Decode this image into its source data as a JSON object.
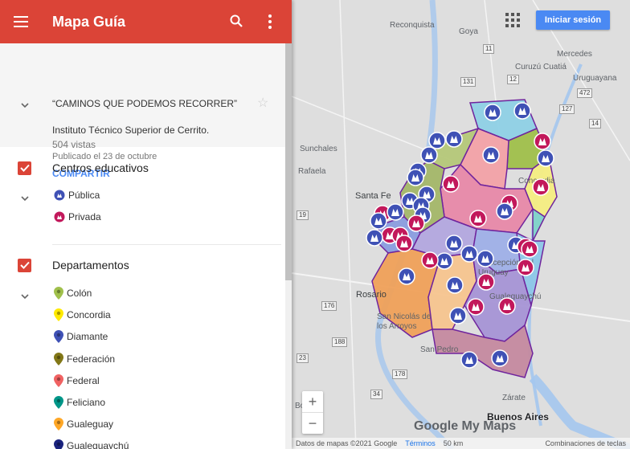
{
  "app_title": "Mapa Guía",
  "map_info": {
    "title": "“CAMINOS QUE PODEMOS RECORRER”",
    "description": "Instituto Técnico Superior de Cerrito.",
    "views": "504 vistas",
    "published": "Publicado el 23 de octubre",
    "share_label": "COMPARTIR"
  },
  "layers": [
    {
      "name": "Centros educativos",
      "items": [
        {
          "label": "Pública",
          "color": "#3f51b5",
          "icon": "school-pin-icon"
        },
        {
          "label": "Privada",
          "color": "#c2185b",
          "icon": "school-pin-icon"
        }
      ]
    },
    {
      "name": "Departamentos",
      "items": [
        {
          "label": "Colón",
          "color": "#a0c04b",
          "icon": "map-pin-icon"
        },
        {
          "label": "Concordia",
          "color": "#ffea00",
          "icon": "map-pin-icon"
        },
        {
          "label": "Diamante",
          "color": "#3f51b5",
          "icon": "map-pin-icon"
        },
        {
          "label": "Federación",
          "color": "#827717",
          "icon": "map-pin-icon"
        },
        {
          "label": "Federal",
          "color": "#f06262",
          "icon": "map-pin-icon"
        },
        {
          "label": "Feliciano",
          "color": "#009688",
          "icon": "map-pin-icon"
        },
        {
          "label": "Gualeguay",
          "color": "#ffa726",
          "icon": "map-pin-icon"
        },
        {
          "label": "Gualeguaychú",
          "color": "#1a237e",
          "icon": "map-pin-icon"
        }
      ]
    }
  ],
  "map": {
    "signin_label": "Iniciar sesión",
    "labels": {
      "reconquista": "Reconquista",
      "goya": "Goya",
      "curuzu": "Curuzú Cuatiá",
      "mercedes": "Mercedes",
      "uruguayana": "Uruguayana",
      "sunchales": "Sunchales",
      "rafaela": "Rafaela",
      "santafe": "Santa Fe",
      "concordia": "Concordia",
      "concepcion": "Concepción del Uruguay",
      "rosario": "Rosario",
      "sannicolas": "San Nicolás de los Arroyos",
      "sanpedro": "San Pedro",
      "buenosaires": "Buenos Aires",
      "zarate": "Zárate",
      "bolivar": "Bolívar",
      "gualeguaychu": "Gualeguaychú"
    },
    "routes": [
      "11",
      "12",
      "14",
      "19",
      "23",
      "34",
      "127",
      "131",
      "176",
      "178",
      "188",
      "472"
    ],
    "logo": "Google My Maps",
    "footer": {
      "attribution": "Datos de mapas ©2021 Google",
      "terms": "Términos",
      "scale": "50 km",
      "shortcuts": "Combinaciones de teclas"
    },
    "zoom_in": "+",
    "zoom_out": "−"
  },
  "colors": {
    "header": "#db4437",
    "accent": "#4a89f3",
    "public_marker": "#3f51b5",
    "private_marker": "#c2185b"
  }
}
